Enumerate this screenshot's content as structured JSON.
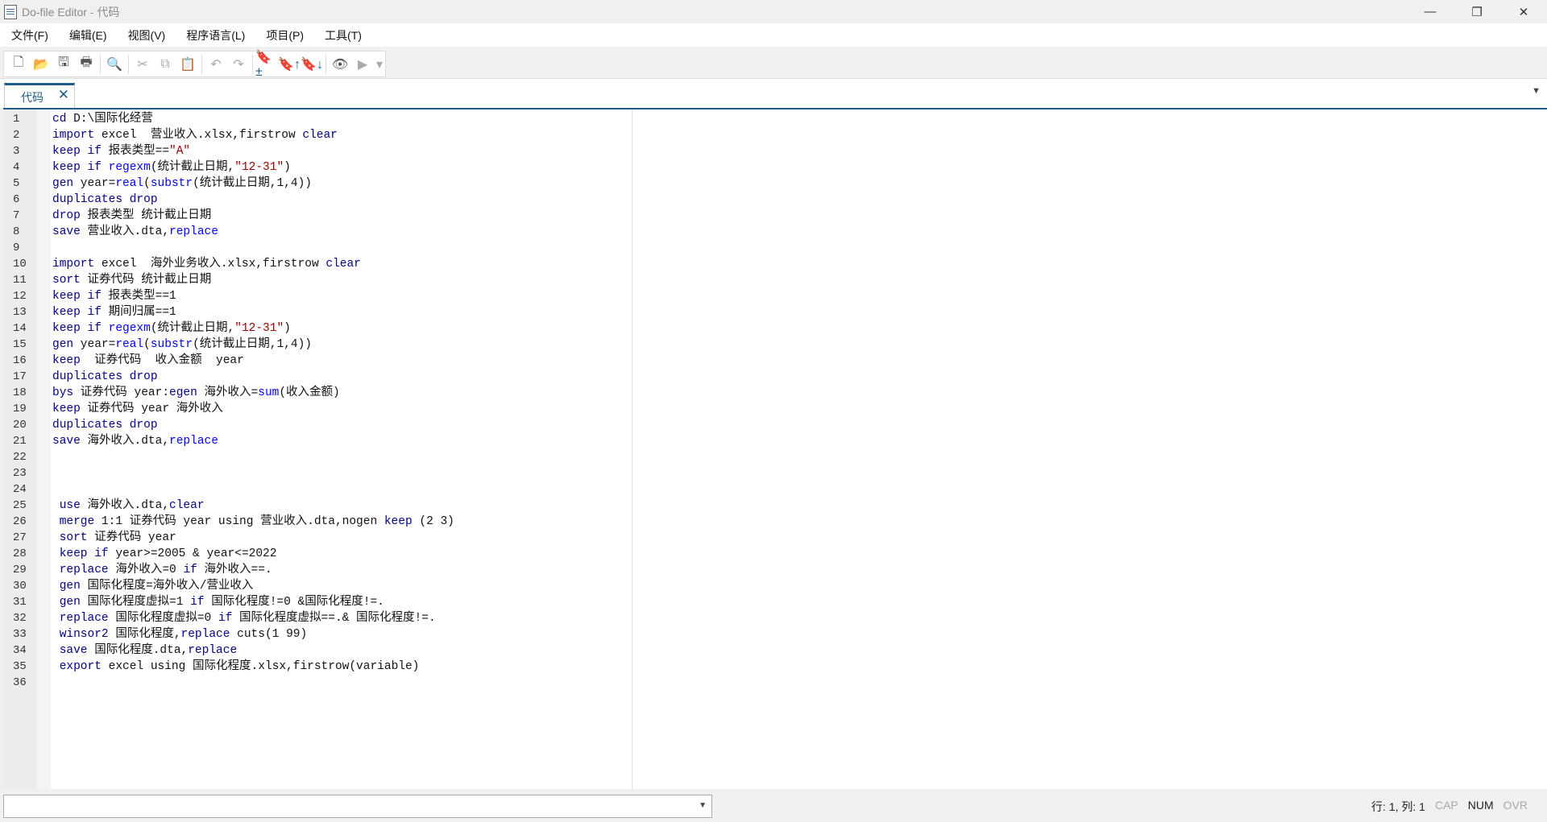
{
  "window": {
    "title": "Do-file Editor - 代码",
    "minimize": "—",
    "restore": "❐",
    "close": "✕"
  },
  "menu": [
    "文件(F)",
    "编辑(E)",
    "视图(V)",
    "程序语言(L)",
    "项目(P)",
    "工具(T)"
  ],
  "toolbar": [
    {
      "name": "new-file-icon",
      "glyph": "🗋"
    },
    {
      "name": "open-folder-icon",
      "glyph": "📂"
    },
    {
      "name": "save-icon",
      "glyph": "🖫"
    },
    {
      "name": "print-icon",
      "glyph": "🖶"
    },
    {
      "sep": true
    },
    {
      "name": "find-icon",
      "glyph": "🔍"
    },
    {
      "sep": true
    },
    {
      "name": "cut-icon",
      "glyph": "✂"
    },
    {
      "name": "copy-icon",
      "glyph": "⧉"
    },
    {
      "name": "paste-icon",
      "glyph": "📋"
    },
    {
      "sep": true
    },
    {
      "name": "undo-icon",
      "glyph": "↶"
    },
    {
      "name": "redo-icon",
      "glyph": "↷"
    },
    {
      "sep": true
    },
    {
      "name": "toggle-bookmark-icon",
      "glyph": "🔖±"
    },
    {
      "name": "previous-bookmark-icon",
      "glyph": "🔖↑"
    },
    {
      "name": "next-bookmark-icon",
      "glyph": "🔖↓"
    },
    {
      "sep": true
    },
    {
      "name": "show-file-icon",
      "glyph": "👁"
    },
    {
      "name": "execute-icon",
      "glyph": "▶"
    },
    {
      "name": "execute-dropdown-icon",
      "glyph": "▾"
    }
  ],
  "tab": {
    "label": "代码",
    "close": "✕",
    "menu": "▼"
  },
  "code": [
    [
      [
        "kw",
        "cd"
      ],
      [
        "tx",
        " D:\\国际化经营"
      ]
    ],
    [
      [
        "kw",
        "import"
      ],
      [
        "tx",
        " excel  营业收入.xlsx,firstrow "
      ],
      [
        "kw",
        "clear"
      ]
    ],
    [
      [
        "kw",
        "keep if"
      ],
      [
        "tx",
        " 报表类型=="
      ],
      [
        "str",
        "\"A\""
      ]
    ],
    [
      [
        "kw",
        "keep if"
      ],
      [
        "tx",
        " "
      ],
      [
        "fn",
        "regexm"
      ],
      [
        "tx",
        "(统计截止日期,"
      ],
      [
        "str",
        "\"12-31\""
      ],
      [
        "tx",
        ")"
      ]
    ],
    [
      [
        "kw",
        "gen"
      ],
      [
        "tx",
        " year="
      ],
      [
        "fn",
        "real"
      ],
      [
        "tx",
        "("
      ],
      [
        "fn",
        "substr"
      ],
      [
        "tx",
        "(统计截止日期,1,4))"
      ]
    ],
    [
      [
        "kw",
        "duplicates drop"
      ]
    ],
    [
      [
        "kw",
        "drop"
      ],
      [
        "tx",
        " 报表类型 统计截止日期"
      ]
    ],
    [
      [
        "kw",
        "save"
      ],
      [
        "tx",
        " 营业收入.dta,"
      ],
      [
        "fn",
        "replace"
      ]
    ],
    [],
    [
      [
        "kw",
        "import"
      ],
      [
        "tx",
        " excel  海外业务收入.xlsx,firstrow "
      ],
      [
        "kw",
        "clear"
      ]
    ],
    [
      [
        "kw",
        "sort"
      ],
      [
        "tx",
        " 证券代码 统计截止日期"
      ]
    ],
    [
      [
        "kw",
        "keep if"
      ],
      [
        "tx",
        " 报表类型==1"
      ]
    ],
    [
      [
        "kw",
        "keep if"
      ],
      [
        "tx",
        " 期间归属==1"
      ]
    ],
    [
      [
        "kw",
        "keep if"
      ],
      [
        "tx",
        " "
      ],
      [
        "fn",
        "regexm"
      ],
      [
        "tx",
        "(统计截止日期,"
      ],
      [
        "str",
        "\"12-31\""
      ],
      [
        "tx",
        ")"
      ]
    ],
    [
      [
        "kw",
        "gen"
      ],
      [
        "tx",
        " year="
      ],
      [
        "fn",
        "real"
      ],
      [
        "tx",
        "("
      ],
      [
        "fn",
        "substr"
      ],
      [
        "tx",
        "(统计截止日期,1,4))"
      ]
    ],
    [
      [
        "kw",
        "keep"
      ],
      [
        "tx",
        "  证券代码  收入金额  year"
      ]
    ],
    [
      [
        "kw",
        "duplicates drop"
      ]
    ],
    [
      [
        "kw",
        "bys"
      ],
      [
        "tx",
        " 证券代码 year:"
      ],
      [
        "kw",
        "egen"
      ],
      [
        "tx",
        " 海外收入="
      ],
      [
        "fn",
        "sum"
      ],
      [
        "tx",
        "(收入金额)"
      ]
    ],
    [
      [
        "kw",
        "keep"
      ],
      [
        "tx",
        " 证券代码 year 海外收入"
      ]
    ],
    [
      [
        "kw",
        "duplicates drop"
      ]
    ],
    [
      [
        "kw",
        "save"
      ],
      [
        "tx",
        " 海外收入.dta,"
      ],
      [
        "fn",
        "replace"
      ]
    ],
    [],
    [],
    [],
    [
      [
        "tx",
        " "
      ],
      [
        "kw",
        "use"
      ],
      [
        "tx",
        " 海外收入.dta,"
      ],
      [
        "kw",
        "clear"
      ]
    ],
    [
      [
        "tx",
        " "
      ],
      [
        "kw",
        "merge"
      ],
      [
        "tx",
        " 1:1 证券代码 year using 营业收入.dta,nogen "
      ],
      [
        "kw",
        "keep"
      ],
      [
        "tx",
        " (2 3)"
      ]
    ],
    [
      [
        "tx",
        " "
      ],
      [
        "kw",
        "sort"
      ],
      [
        "tx",
        " 证券代码 year"
      ]
    ],
    [
      [
        "tx",
        " "
      ],
      [
        "kw",
        "keep if"
      ],
      [
        "tx",
        " year>=2005 & year<=2022"
      ]
    ],
    [
      [
        "tx",
        " "
      ],
      [
        "kw",
        "replace"
      ],
      [
        "tx",
        " 海外收入=0 "
      ],
      [
        "kw",
        "if"
      ],
      [
        "tx",
        " 海外收入==."
      ]
    ],
    [
      [
        "tx",
        " "
      ],
      [
        "kw",
        "gen"
      ],
      [
        "tx",
        " 国际化程度=海外收入/营业收入"
      ]
    ],
    [
      [
        "tx",
        " "
      ],
      [
        "kw",
        "gen"
      ],
      [
        "tx",
        " 国际化程度虚拟=1 "
      ],
      [
        "kw",
        "if"
      ],
      [
        "tx",
        " 国际化程度!=0 &国际化程度!=."
      ]
    ],
    [
      [
        "tx",
        " "
      ],
      [
        "kw",
        "replace"
      ],
      [
        "tx",
        " 国际化程度虚拟=0 "
      ],
      [
        "kw",
        "if"
      ],
      [
        "tx",
        " 国际化程度虚拟==.& 国际化程度!=."
      ]
    ],
    [
      [
        "tx",
        " "
      ],
      [
        "kw",
        "winsor2"
      ],
      [
        "tx",
        " 国际化程度,"
      ],
      [
        "kw",
        "replace"
      ],
      [
        "tx",
        " cuts(1 99)"
      ]
    ],
    [
      [
        "tx",
        " "
      ],
      [
        "kw",
        "save"
      ],
      [
        "tx",
        " 国际化程度.dta,"
      ],
      [
        "kw",
        "replace"
      ]
    ],
    [
      [
        "tx",
        " "
      ],
      [
        "kw",
        "export"
      ],
      [
        "tx",
        " excel using 国际化程度.xlsx,firstrow(variable)"
      ]
    ],
    []
  ],
  "command": {
    "value": "",
    "dropdown": "▼"
  },
  "status": {
    "position": "行: 1, 列: 1",
    "cap": "CAP",
    "num": "NUM",
    "ovr": "OVR"
  }
}
